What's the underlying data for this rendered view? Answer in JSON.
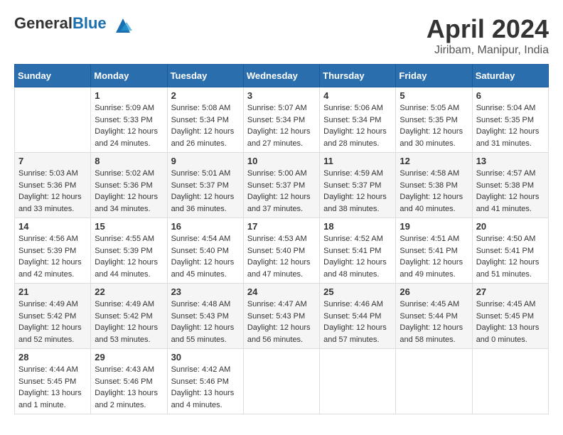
{
  "header": {
    "logo_general": "General",
    "logo_blue": "Blue",
    "title": "April 2024",
    "location": "Jiribam, Manipur, India"
  },
  "days_of_week": [
    "Sunday",
    "Monday",
    "Tuesday",
    "Wednesday",
    "Thursday",
    "Friday",
    "Saturday"
  ],
  "weeks": [
    [
      {
        "day": "",
        "info": ""
      },
      {
        "day": "1",
        "info": "Sunrise: 5:09 AM\nSunset: 5:33 PM\nDaylight: 12 hours\nand 24 minutes."
      },
      {
        "day": "2",
        "info": "Sunrise: 5:08 AM\nSunset: 5:34 PM\nDaylight: 12 hours\nand 26 minutes."
      },
      {
        "day": "3",
        "info": "Sunrise: 5:07 AM\nSunset: 5:34 PM\nDaylight: 12 hours\nand 27 minutes."
      },
      {
        "day": "4",
        "info": "Sunrise: 5:06 AM\nSunset: 5:34 PM\nDaylight: 12 hours\nand 28 minutes."
      },
      {
        "day": "5",
        "info": "Sunrise: 5:05 AM\nSunset: 5:35 PM\nDaylight: 12 hours\nand 30 minutes."
      },
      {
        "day": "6",
        "info": "Sunrise: 5:04 AM\nSunset: 5:35 PM\nDaylight: 12 hours\nand 31 minutes."
      }
    ],
    [
      {
        "day": "7",
        "info": "Sunrise: 5:03 AM\nSunset: 5:36 PM\nDaylight: 12 hours\nand 33 minutes."
      },
      {
        "day": "8",
        "info": "Sunrise: 5:02 AM\nSunset: 5:36 PM\nDaylight: 12 hours\nand 34 minutes."
      },
      {
        "day": "9",
        "info": "Sunrise: 5:01 AM\nSunset: 5:37 PM\nDaylight: 12 hours\nand 36 minutes."
      },
      {
        "day": "10",
        "info": "Sunrise: 5:00 AM\nSunset: 5:37 PM\nDaylight: 12 hours\nand 37 minutes."
      },
      {
        "day": "11",
        "info": "Sunrise: 4:59 AM\nSunset: 5:37 PM\nDaylight: 12 hours\nand 38 minutes."
      },
      {
        "day": "12",
        "info": "Sunrise: 4:58 AM\nSunset: 5:38 PM\nDaylight: 12 hours\nand 40 minutes."
      },
      {
        "day": "13",
        "info": "Sunrise: 4:57 AM\nSunset: 5:38 PM\nDaylight: 12 hours\nand 41 minutes."
      }
    ],
    [
      {
        "day": "14",
        "info": "Sunrise: 4:56 AM\nSunset: 5:39 PM\nDaylight: 12 hours\nand 42 minutes."
      },
      {
        "day": "15",
        "info": "Sunrise: 4:55 AM\nSunset: 5:39 PM\nDaylight: 12 hours\nand 44 minutes."
      },
      {
        "day": "16",
        "info": "Sunrise: 4:54 AM\nSunset: 5:40 PM\nDaylight: 12 hours\nand 45 minutes."
      },
      {
        "day": "17",
        "info": "Sunrise: 4:53 AM\nSunset: 5:40 PM\nDaylight: 12 hours\nand 47 minutes."
      },
      {
        "day": "18",
        "info": "Sunrise: 4:52 AM\nSunset: 5:41 PM\nDaylight: 12 hours\nand 48 minutes."
      },
      {
        "day": "19",
        "info": "Sunrise: 4:51 AM\nSunset: 5:41 PM\nDaylight: 12 hours\nand 49 minutes."
      },
      {
        "day": "20",
        "info": "Sunrise: 4:50 AM\nSunset: 5:41 PM\nDaylight: 12 hours\nand 51 minutes."
      }
    ],
    [
      {
        "day": "21",
        "info": "Sunrise: 4:49 AM\nSunset: 5:42 PM\nDaylight: 12 hours\nand 52 minutes."
      },
      {
        "day": "22",
        "info": "Sunrise: 4:49 AM\nSunset: 5:42 PM\nDaylight: 12 hours\nand 53 minutes."
      },
      {
        "day": "23",
        "info": "Sunrise: 4:48 AM\nSunset: 5:43 PM\nDaylight: 12 hours\nand 55 minutes."
      },
      {
        "day": "24",
        "info": "Sunrise: 4:47 AM\nSunset: 5:43 PM\nDaylight: 12 hours\nand 56 minutes."
      },
      {
        "day": "25",
        "info": "Sunrise: 4:46 AM\nSunset: 5:44 PM\nDaylight: 12 hours\nand 57 minutes."
      },
      {
        "day": "26",
        "info": "Sunrise: 4:45 AM\nSunset: 5:44 PM\nDaylight: 12 hours\nand 58 minutes."
      },
      {
        "day": "27",
        "info": "Sunrise: 4:45 AM\nSunset: 5:45 PM\nDaylight: 13 hours\nand 0 minutes."
      }
    ],
    [
      {
        "day": "28",
        "info": "Sunrise: 4:44 AM\nSunset: 5:45 PM\nDaylight: 13 hours\nand 1 minute."
      },
      {
        "day": "29",
        "info": "Sunrise: 4:43 AM\nSunset: 5:46 PM\nDaylight: 13 hours\nand 2 minutes."
      },
      {
        "day": "30",
        "info": "Sunrise: 4:42 AM\nSunset: 5:46 PM\nDaylight: 13 hours\nand 4 minutes."
      },
      {
        "day": "",
        "info": ""
      },
      {
        "day": "",
        "info": ""
      },
      {
        "day": "",
        "info": ""
      },
      {
        "day": "",
        "info": ""
      }
    ]
  ]
}
